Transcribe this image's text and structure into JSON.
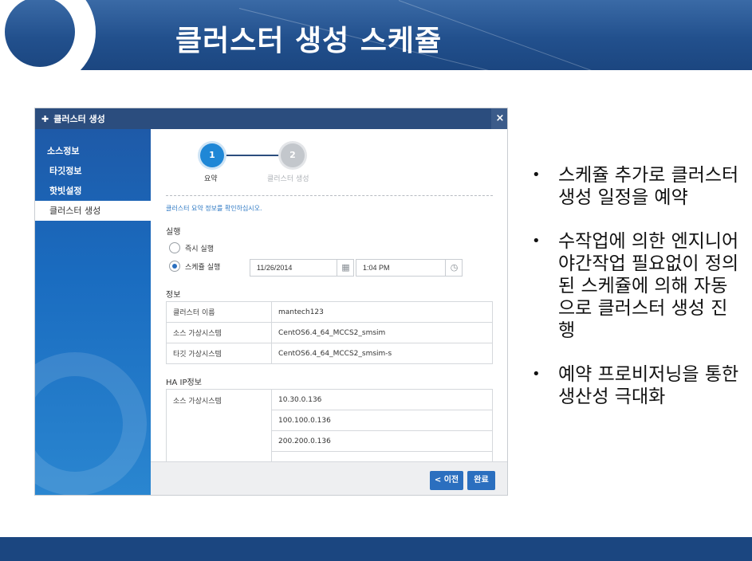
{
  "slide": {
    "title": "클러스터 생성 스케쥴",
    "bullets": [
      "스케쥴 추가로 클러스터 생성 일정을 예약",
      "수작업에 의한 엔지니어 야간작업 필요없이 정의된 스케쥴에 의해 자동으로 클러스터 생성 진행",
      "예약 프로비저닝을 통한 생산성 극대화"
    ]
  },
  "dialog": {
    "title": "클러스터 생성",
    "close": "×",
    "sidebar": [
      "소스정보",
      "타깃정보",
      "핫빗설정",
      "클러스터 생성"
    ],
    "steps": [
      {
        "number": "1",
        "label": "요약"
      },
      {
        "number": "2",
        "label": "클러스터 생성"
      }
    ],
    "info_text": "클러스터 요약 정보를 확인하십시오.",
    "execution": {
      "label": "실행",
      "option_now": "즉시 실행",
      "option_schedule": "스케쥴 실행",
      "date": "11/26/2014",
      "time": "1:04 PM"
    },
    "info": {
      "label": "정보",
      "rows": [
        {
          "key": "클러스터 이름",
          "value": "mantech123"
        },
        {
          "key": "소스 가상시스템",
          "value": "CentOS6.4_64_MCCS2_smsim"
        },
        {
          "key": "타깃 가상시스템",
          "value": "CentOS6.4_64_MCCS2_smsim-s"
        }
      ]
    },
    "ha_ip": {
      "label": "HA IP정보",
      "key": "소스 가상시스템",
      "values": [
        "10.30.0.136",
        "100.100.0.136",
        "200.200.0.136"
      ]
    },
    "buttons": {
      "prev": "< 이전",
      "done": "완료"
    }
  }
}
